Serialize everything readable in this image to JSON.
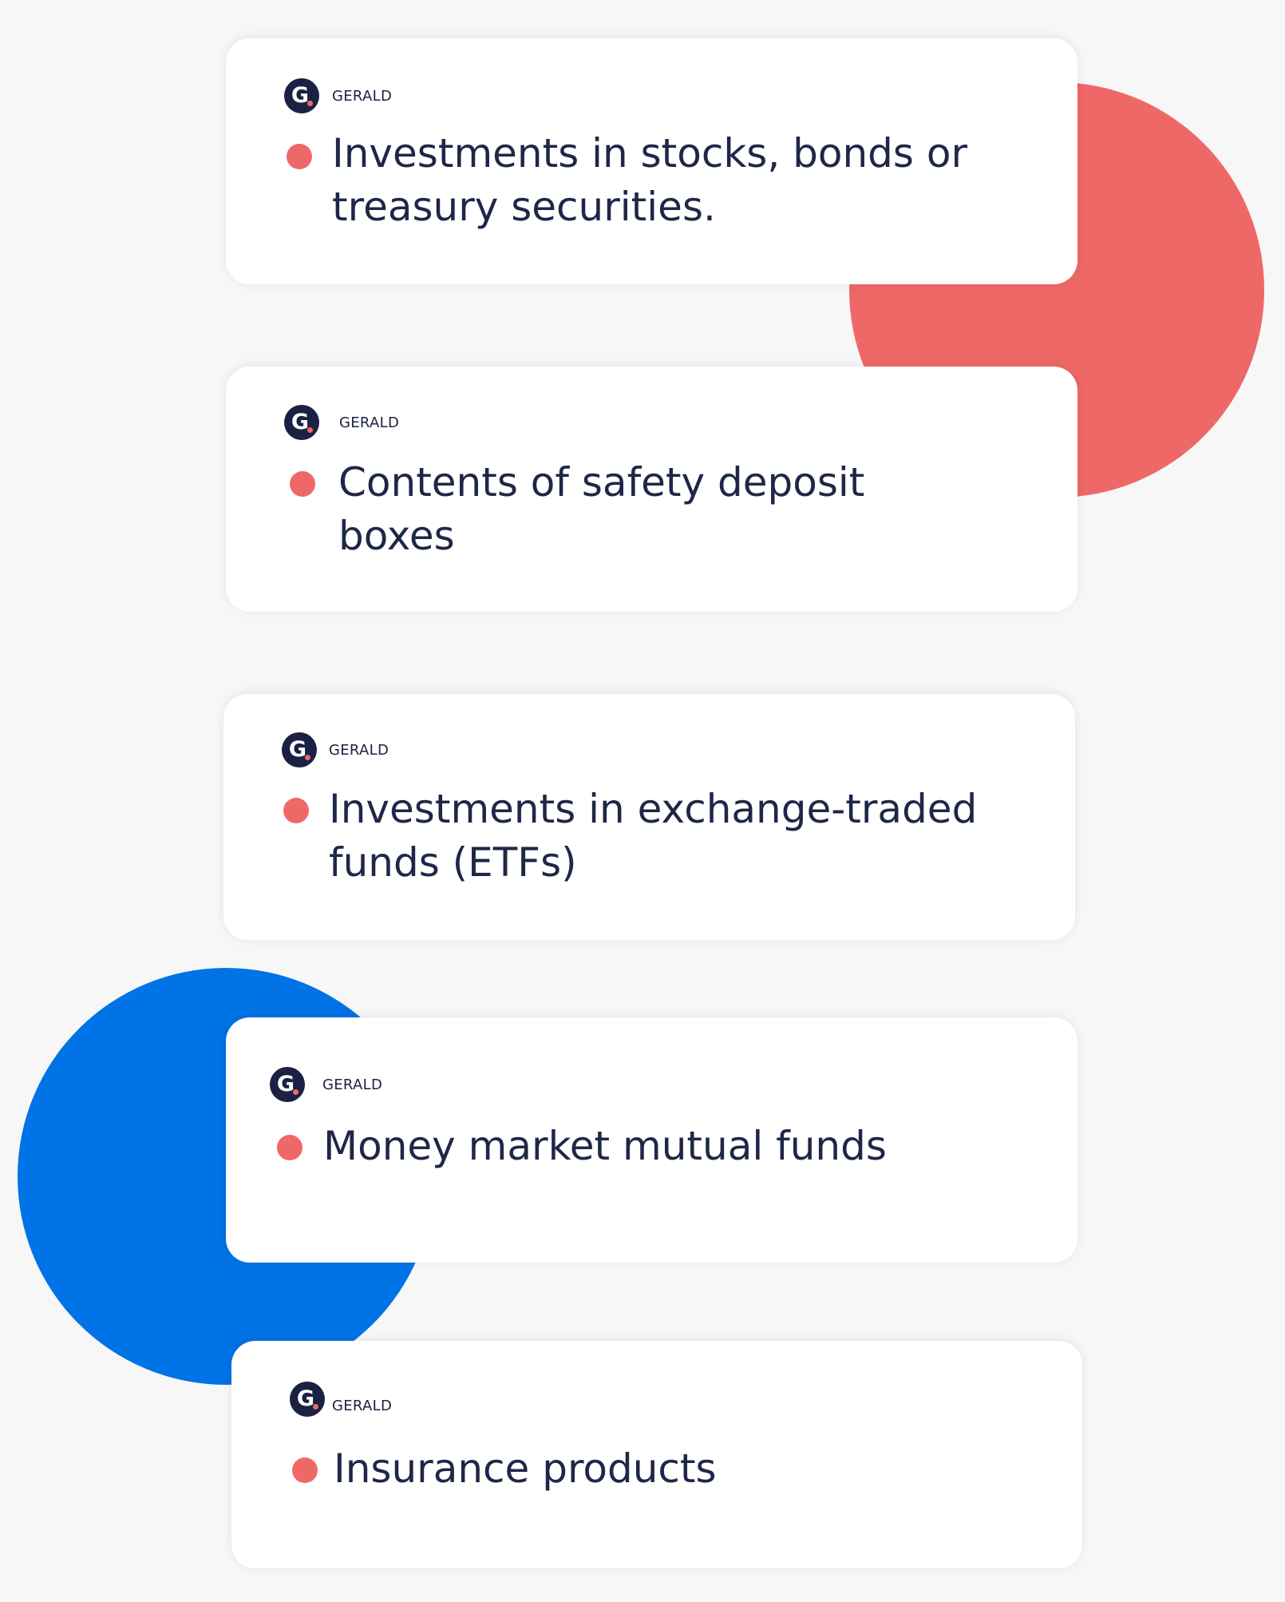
{
  "colors": {
    "background": "#f7f7f7",
    "card": "#ffffff",
    "accent_red": "#ef6868",
    "accent_blue": "#0073e6",
    "text_dark": "#1f2748",
    "logo_bg": "#1b2143"
  },
  "brand": {
    "logo_letter": "G",
    "name": "GERALD"
  },
  "cards": [
    {
      "text": "Investments in stocks, bonds or treasury securities."
    },
    {
      "text": "Contents of safety deposit boxes"
    },
    {
      "text": "Investments in exchange-traded funds (ETFs)"
    },
    {
      "text": "Money market mutual funds"
    },
    {
      "text": "Insurance products"
    }
  ]
}
